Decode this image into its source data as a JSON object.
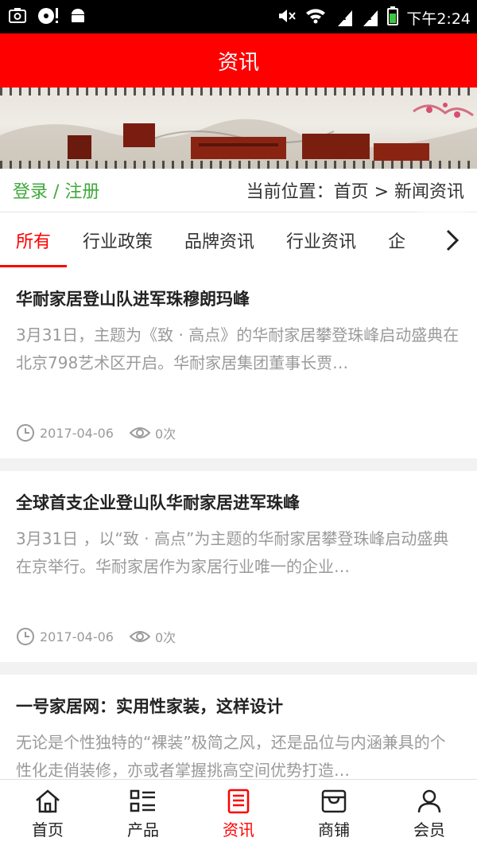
{
  "status_bar": {
    "time": "下午2:24",
    "signal_label_1": "1",
    "signal_label_2": "1"
  },
  "header": {
    "title": "资讯"
  },
  "breadcrumb": {
    "login": "登录 / 注册",
    "location": "当前位置：首页 > 新闻资讯"
  },
  "tabs": [
    {
      "label": "所有",
      "active": true
    },
    {
      "label": "行业政策"
    },
    {
      "label": "品牌资讯"
    },
    {
      "label": "行业资讯"
    },
    {
      "label": "企"
    }
  ],
  "news": [
    {
      "title": "华耐家居登山队进军珠穆朗玛峰",
      "summary": "3月31日，主题为《致 · 高点》的华耐家居攀登珠峰启动盛典在北京798艺术区开启。华耐家居集团董事长贾…",
      "date": "2017-04-06",
      "views": "0次"
    },
    {
      "title": "全球首支企业登山队华耐家居进军珠峰",
      "summary": "3月31日 ，以“致 · 高点”为主题的华耐家居攀登珠峰启动盛典在京举行。华耐家居作为家居行业唯一的企业…",
      "date": "2017-04-06",
      "views": "0次"
    },
    {
      "title": "一号家居网：实用性家装，这样设计",
      "summary": "无论是个性独特的“裸装”极简之风，还是品位与内涵兼具的个性化走俏装修，亦或者掌握挑高空间优势打造…",
      "date": "",
      "views": ""
    }
  ],
  "bottom_nav": [
    {
      "label": "首页",
      "icon": "home-icon"
    },
    {
      "label": "产品",
      "icon": "product-list-icon"
    },
    {
      "label": "资讯",
      "icon": "news-icon",
      "active": true
    },
    {
      "label": "商铺",
      "icon": "store-icon"
    },
    {
      "label": "会员",
      "icon": "user-icon"
    }
  ],
  "colors": {
    "accent": "#fe0000",
    "login_green": "#3fa93b",
    "muted_text": "#9a9a9a"
  }
}
